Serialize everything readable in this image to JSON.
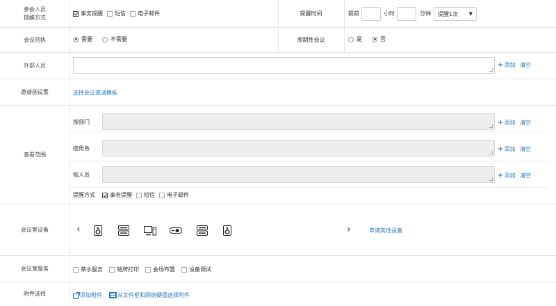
{
  "reminder": {
    "label": "参会人员\n提醒方式",
    "options": [
      {
        "text": "事务提醒",
        "checked": true
      },
      {
        "text": "短信",
        "checked": false
      },
      {
        "text": "电子邮件",
        "checked": false
      }
    ],
    "time_label": "提醒时间",
    "before_text": "提前",
    "hour_unit": "小时",
    "minute_unit": "分钟",
    "count_value": "提醒1次",
    "dropdown_arrow": "▼"
  },
  "receipt": {
    "label": "会议回执",
    "options": [
      {
        "text": "需要",
        "selected": true
      },
      {
        "text": "不需要",
        "selected": false
      }
    ],
    "periodic_label": "周期性会议",
    "periodic_options": [
      {
        "text": "是",
        "selected": false
      },
      {
        "text": "否",
        "selected": true
      }
    ]
  },
  "external": {
    "label": "外部人员",
    "add": "添加",
    "clear": "清空"
  },
  "invitation": {
    "label": "邀请函设置",
    "link": "选择会议邀请模板"
  },
  "scope": {
    "label": "查看范围",
    "by_department": "按部门",
    "by_role": "按角色",
    "by_person": "按人员",
    "add": "添加",
    "clear": "清空",
    "remind_label": "提醒方式",
    "options": [
      {
        "text": "事务提醒",
        "checked": true
      },
      {
        "text": "短信",
        "checked": false
      },
      {
        "text": "电子邮件",
        "checked": false
      }
    ]
  },
  "equipment": {
    "label": "会议室设备",
    "prev": "‹",
    "next": "›",
    "icons": [
      "speaker-icon",
      "server-icon",
      "monitor-icon",
      "projector-icon",
      "server-icon",
      "speaker-icon"
    ],
    "apply": "申请其他设备"
  },
  "service": {
    "label": "会议室服务",
    "options": [
      {
        "text": "茶水服务",
        "checked": false
      },
      {
        "text": "铭牌打印",
        "checked": false
      },
      {
        "text": "会场布置",
        "checked": false
      },
      {
        "text": "设备调试",
        "checked": false
      }
    ]
  },
  "attachment": {
    "label": "附件选择",
    "add": "添加附件",
    "from_cabinet": "从文件柜和网络硬盘选择附件"
  },
  "colors": {
    "link": "#2a7ac0",
    "border": "#e6e6e6",
    "disabled": "#eeeeee"
  }
}
